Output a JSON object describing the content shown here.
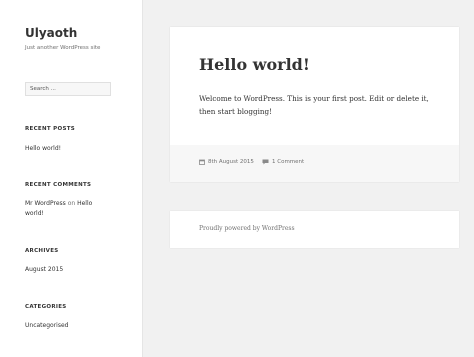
{
  "site": {
    "title": "Ulyaoth",
    "description": "Just another WordPress site"
  },
  "search": {
    "placeholder": "Search ..."
  },
  "widgets": {
    "recent_posts": {
      "title": "RECENT POSTS",
      "items": [
        "Hello world!"
      ]
    },
    "recent_comments": {
      "title": "RECENT COMMENTS",
      "author": "Mr WordPress",
      "on": "on",
      "post_line1": "Hello",
      "post_line2": "world!"
    },
    "archives": {
      "title": "ARCHIVES",
      "items": [
        "August 2015"
      ]
    },
    "categories": {
      "title": "CATEGORIES",
      "items": [
        "Uncategorised"
      ]
    }
  },
  "post": {
    "title": "Hello world!",
    "content": "Welcome to WordPress. This is your first post. Edit or delete it, then start blogging!",
    "date": "8th August 2015",
    "comments": "1 Comment"
  },
  "footer": {
    "credit": "Proudly powered by WordPress"
  },
  "icons": {
    "date": "calendar-icon",
    "comments": "comment-icon"
  }
}
